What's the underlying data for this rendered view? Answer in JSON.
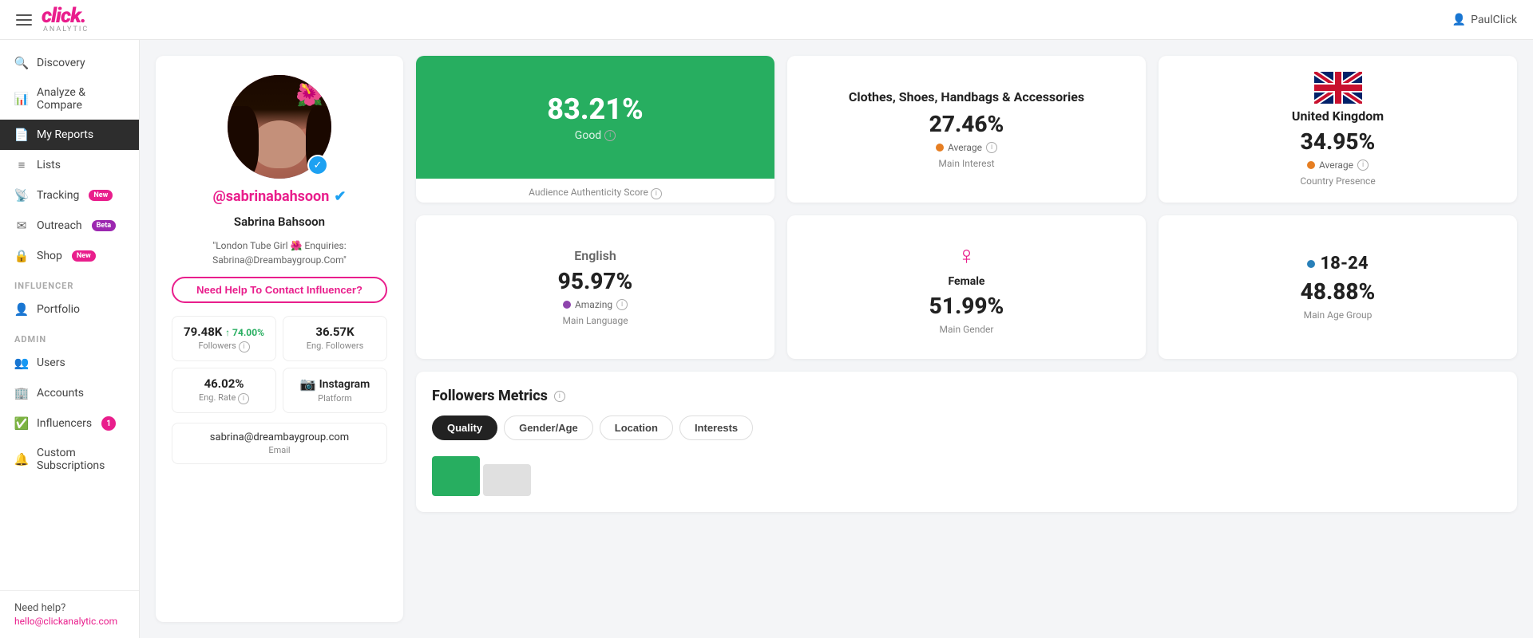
{
  "topbar": {
    "user": "PaulClick"
  },
  "sidebar": {
    "nav_items": [
      {
        "id": "discovery",
        "label": "Discovery",
        "icon": "🔍",
        "active": false
      },
      {
        "id": "analyze",
        "label": "Analyze & Compare",
        "icon": "📊",
        "active": false
      },
      {
        "id": "my-reports",
        "label": "My Reports",
        "icon": "📄",
        "active": true
      },
      {
        "id": "lists",
        "label": "Lists",
        "icon": "≡",
        "active": false
      },
      {
        "id": "tracking",
        "label": "Tracking",
        "icon": "📡",
        "badge": "New",
        "badge_type": "new",
        "active": false
      },
      {
        "id": "outreach",
        "label": "Outreach",
        "icon": "✉",
        "badge": "Beta",
        "badge_type": "beta",
        "active": false
      },
      {
        "id": "shop",
        "label": "Shop",
        "icon": "🔒",
        "badge": "New",
        "badge_type": "new",
        "active": false
      }
    ],
    "influencer_section": "INFLUENCER",
    "influencer_items": [
      {
        "id": "portfolio",
        "label": "Portfolio",
        "icon": "👤"
      }
    ],
    "admin_section": "ADMIN",
    "admin_items": [
      {
        "id": "users",
        "label": "Users",
        "icon": "👥"
      },
      {
        "id": "accounts",
        "label": "Accounts",
        "icon": "🏢"
      },
      {
        "id": "influencers",
        "label": "Influencers",
        "icon": "✅",
        "count": 1
      },
      {
        "id": "custom-subs",
        "label": "Custom Subscriptions",
        "icon": "🔔"
      }
    ],
    "help_text": "Need help?",
    "help_email": "hello@clickanalytic.com"
  },
  "profile": {
    "handle": "@sabrinabahsoon",
    "name": "Sabrina Bahsoon",
    "bio": "\"London Tube Girl 🌺 Enquiries: Sabrina@Dreambaygroup.Com\"",
    "contact_btn": "Need Help To Contact Influencer?",
    "followers_value": "79.48K",
    "followers_growth": "↑ 74.00%",
    "followers_label": "Followers",
    "eng_followers_value": "36.57K",
    "eng_followers_label": "Eng. Followers",
    "eng_rate_value": "46.02%",
    "eng_rate_label": "Eng. Rate",
    "platform_label": "Instagram",
    "platform_sub": "Platform",
    "email_value": "sabrina@dreambaygroup.com",
    "email_label": "Email"
  },
  "metrics": {
    "authenticity": {
      "percentage": "83.21%",
      "rating": "Good",
      "label": "Audience Authenticity Score"
    },
    "main_interest": {
      "title": "Clothes, Shoes, Handbags & Accessories",
      "percentage": "27.46%",
      "badge": "Average",
      "sub_label": "Main Interest"
    },
    "location": {
      "country": "United Kingdom",
      "percentage": "34.95%",
      "badge": "Average",
      "sub_label": "Country Presence"
    },
    "language": {
      "lang": "English",
      "percentage": "95.97%",
      "badge": "Amazing",
      "sub_label": "Main Language"
    },
    "gender": {
      "gender": "Female",
      "percentage": "51.99%",
      "sub_label": "Main Gender"
    },
    "age": {
      "group": "18-24",
      "percentage": "48.88%",
      "sub_label": "Main Age Group"
    }
  },
  "followers_metrics": {
    "title": "Followers Metrics",
    "tabs": [
      {
        "id": "quality",
        "label": "Quality",
        "active": true
      },
      {
        "id": "gender-age",
        "label": "Gender/Age",
        "active": false
      },
      {
        "id": "location",
        "label": "Location",
        "active": false
      },
      {
        "id": "interests",
        "label": "Interests",
        "active": false
      }
    ]
  }
}
